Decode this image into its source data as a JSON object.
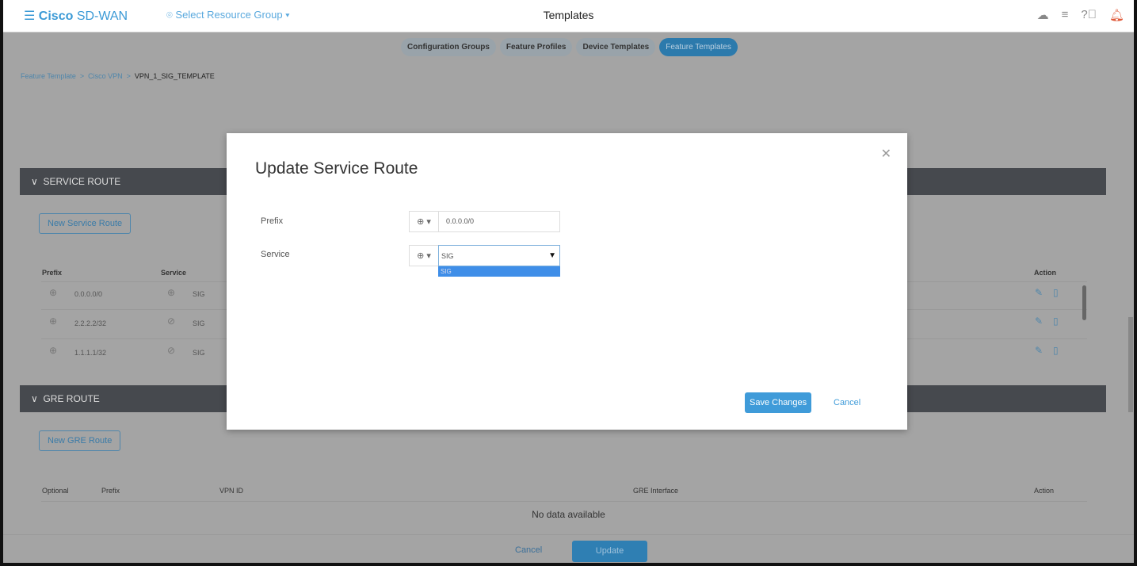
{
  "header": {
    "brand_bold": "Cisco",
    "brand_rest": " SD-WAN",
    "resource_group": "Select Resource Group",
    "title": "Templates"
  },
  "tabs": [
    {
      "label": "Configuration Groups",
      "active": false
    },
    {
      "label": "Feature Profiles",
      "active": false
    },
    {
      "label": "Device Templates",
      "active": false
    },
    {
      "label": "Feature Templates",
      "active": true
    }
  ],
  "breadcrumb": [
    "Feature Template",
    "Cisco VPN",
    "VPN_1_SIG_TEMPLATE"
  ],
  "service_route": {
    "title": "SERVICE ROUTE",
    "new_button": "New Service Route",
    "columns": [
      "Prefix",
      "Service",
      "Action"
    ],
    "rows": [
      {
        "prefix": "0.0.0.0/0",
        "service": "SIG",
        "prefix_icon": "globe",
        "service_icon": "globe"
      },
      {
        "prefix": "2.2.2.2/32",
        "service": "SIG",
        "prefix_icon": "globe",
        "service_icon": "check-circle"
      },
      {
        "prefix": "1.1.1.1/32",
        "service": "SIG",
        "prefix_icon": "globe",
        "service_icon": "check-circle"
      }
    ]
  },
  "gre_route": {
    "title": "GRE ROUTE",
    "new_button": "New GRE Route",
    "columns": [
      "Optional",
      "Prefix",
      "VPN ID",
      "GRE Interface",
      "Action"
    ],
    "empty": "No data available"
  },
  "footer": {
    "cancel": "Cancel",
    "update": "Update"
  },
  "modal": {
    "title": "Update Service Route",
    "prefix_label": "Prefix",
    "prefix_value": "0.0.0.0/0",
    "service_label": "Service",
    "service_value": "SIG",
    "service_options": [
      "SIG"
    ],
    "save": "Save Changes",
    "cancel": "Cancel"
  },
  "colors": {
    "accent": "#3f9bd9",
    "section_header": "#46494e",
    "active_tab": "#2c7aac"
  }
}
